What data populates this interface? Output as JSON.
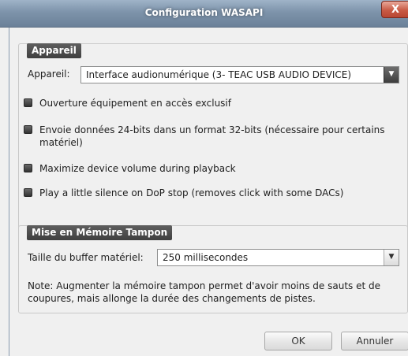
{
  "window": {
    "title": "Configuration WASAPI",
    "close_label": "X"
  },
  "device_group": {
    "title": "Appareil",
    "device_label": "Appareil:",
    "device_value": "Interface audionumérique (3- TEAC USB AUDIO DEVICE)",
    "options": [
      {
        "label": "Ouverture équipement en accès exclusif",
        "checked": true
      },
      {
        "label": "Envoie données 24-bits dans un format 32-bits (nécessaire pour certains matériel)",
        "checked": true
      },
      {
        "label": "Maximize device volume during playback",
        "checked": true
      },
      {
        "label": "Play a little silence on DoP stop (removes click with some DACs)",
        "checked": true
      }
    ]
  },
  "buffer_group": {
    "title": "Mise en Mémoire Tampon",
    "buffer_label": "Taille du buffer matériel:",
    "buffer_value": "250 millisecondes",
    "note": "Note: Augmenter la mémoire tampon permet d'avoir moins de sauts et de coupures, mais allonge la durée des changements de pistes."
  },
  "buttons": {
    "ok": "OK",
    "cancel": "Annuler"
  }
}
